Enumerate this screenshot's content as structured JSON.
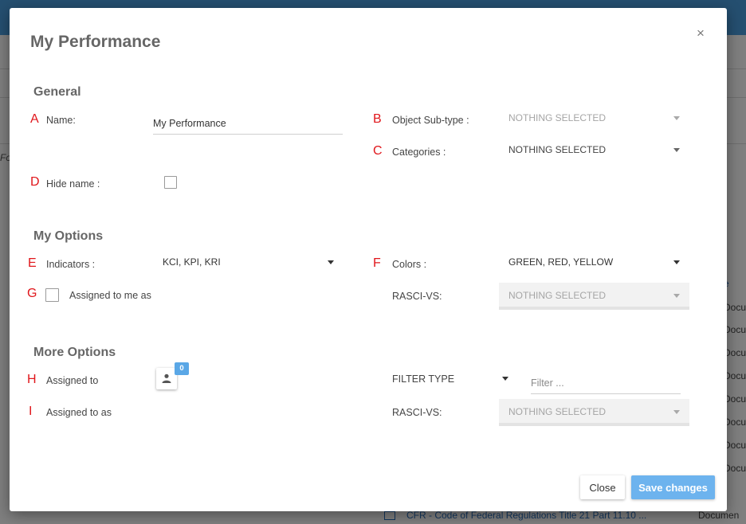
{
  "background": {
    "partial_left_text": "Fo",
    "right_column_header": "e",
    "right_column_cells": [
      "Documen",
      "Documen",
      "Documen",
      "Documen",
      "Documen",
      "Documen",
      "Documen",
      "Documen"
    ],
    "footer_link": "CFR - Code of Federal Regulations Title 21 Part 11.10 ...",
    "footer_doc": "Documen"
  },
  "modal": {
    "title": "My Performance",
    "close_icon": "×",
    "sections": {
      "general": "General",
      "my_options": "My Options",
      "more_options": "More Options"
    },
    "markers": {
      "a": "A",
      "b": "B",
      "c": "C",
      "d": "D",
      "e": "E",
      "f": "F",
      "g": "G",
      "h": "H",
      "i": "I"
    },
    "general": {
      "name_label": "Name:",
      "name_value": "My Performance",
      "object_subtype_label": "Object Sub-type :",
      "object_subtype_value": "NOTHING SELECTED",
      "categories_label": "Categories :",
      "categories_value": "NOTHING SELECTED",
      "hide_name_label": "Hide name :"
    },
    "my_options": {
      "indicators_label": "Indicators :",
      "indicators_value": "KCI, KPI, KRI",
      "colors_label": "Colors :",
      "colors_value": "GREEN, RED, YELLOW",
      "assigned_to_me_label": "Assigned to me as",
      "rasci_label": "RASCI-VS:",
      "rasci_value": "NOTHING SELECTED"
    },
    "more_options": {
      "assigned_to_label": "Assigned to",
      "assigned_badge": "0",
      "assigned_to_as_label": "Assigned to as",
      "filter_type_label": "FILTER TYPE",
      "filter_placeholder": "Filter ...",
      "rasci_label": "RASCI-VS:",
      "rasci_value": "NOTHING SELECTED"
    },
    "buttons": {
      "close": "Close",
      "save": "Save changes"
    }
  },
  "icons": {
    "close": "close-icon",
    "dropdown": "caret-down-icon",
    "user": "user-icon",
    "monitor": "monitor-icon"
  },
  "colors": {
    "marker": "#e0161b",
    "primary_button": "#6db3ee",
    "badge": "#5aa7e6",
    "topbar": "#4a9fe0"
  }
}
